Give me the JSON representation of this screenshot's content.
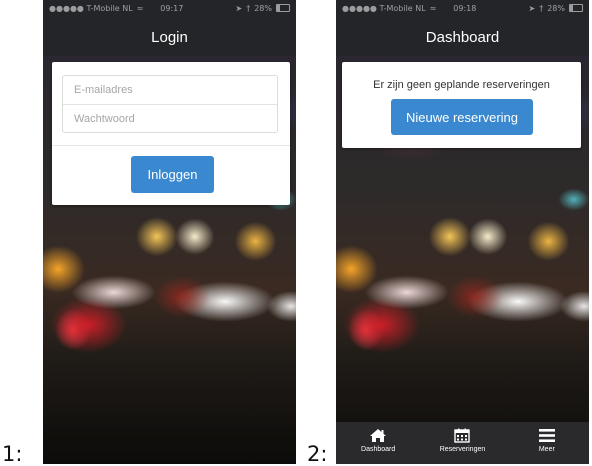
{
  "labels": {
    "first": "1:",
    "second": "2:"
  },
  "login_screen": {
    "status": {
      "carrier": "●●●●● T-Mobile NL",
      "time": "09:17",
      "battery": "28%"
    },
    "title": "Login",
    "email_placeholder": "E-mailadres",
    "password_placeholder": "Wachtwoord",
    "login_button": "Inloggen"
  },
  "dashboard_screen": {
    "status": {
      "carrier": "●●●●● T-Mobile NL",
      "time": "09:18",
      "battery": "28%"
    },
    "title": "Dashboard",
    "empty_message": "Er zijn geen geplande reserveringen",
    "new_button": "Nieuwe reservering",
    "tabs": [
      {
        "label": "Dashboard",
        "icon": "home-icon"
      },
      {
        "label": "Reserveringen",
        "icon": "calendar-icon"
      },
      {
        "label": "Meer",
        "icon": "menu-icon"
      }
    ]
  },
  "colors": {
    "accent": "#3a89d0",
    "nav_bar": "#242528",
    "tab_bar": "#2a2a2c"
  }
}
